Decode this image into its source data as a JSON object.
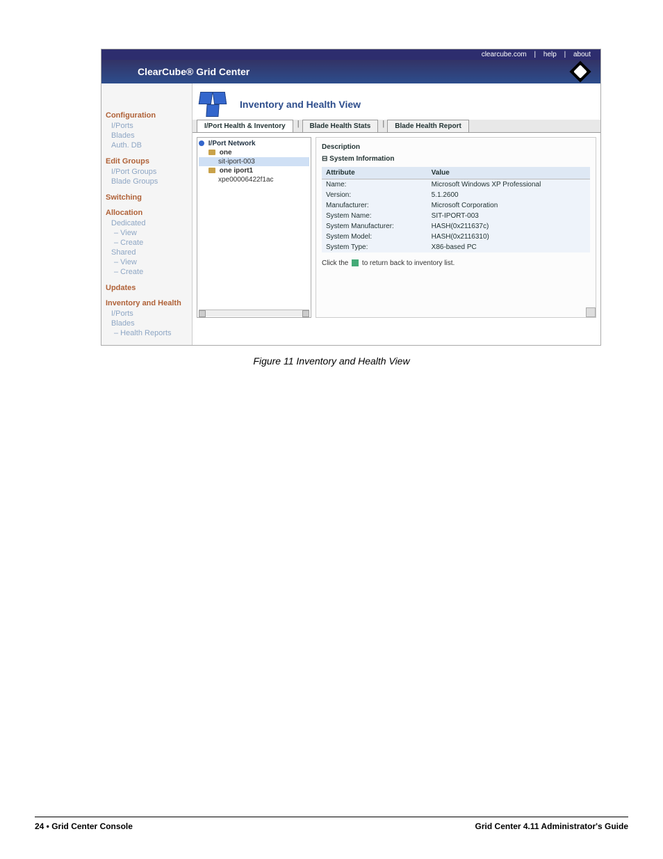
{
  "topbar": {
    "link1": "clearcube.com",
    "link2": "help",
    "link3": "about"
  },
  "brand": {
    "title": "ClearCube® Grid Center"
  },
  "header": {
    "page_title": "Inventory and Health View"
  },
  "tabs": {
    "t1": "I/Port Health & Inventory",
    "t2": "Blade Health Stats",
    "t3": "Blade Health Report"
  },
  "sidebar": {
    "sec1": "Configuration",
    "s1i1": "I/Ports",
    "s1i2": "Blades",
    "s1i3": "Auth. DB",
    "sec2": "Edit Groups",
    "s2i1": "I/Port Groups",
    "s2i2": "Blade Groups",
    "sec3": "Switching",
    "sec4": "Allocation",
    "s4i1": "Dedicated",
    "s4i2": "– View",
    "s4i3": "– Create",
    "s4i4": "Shared",
    "s4i5": "– View",
    "s4i6": "– Create",
    "sec5": "Updates",
    "sec6": "Inventory and Health",
    "s6i1": "I/Ports",
    "s6i2": "Blades",
    "s6i3": "– Health Reports"
  },
  "tree": {
    "root": "I/Port Network",
    "n1": "one",
    "n1a": "sit-iport-003",
    "n2": "one iport1",
    "n2a": "xpe00006422f1ac"
  },
  "detail": {
    "desc": "Description",
    "sysinfo": "⊟ System Information",
    "col1": "Attribute",
    "col2": "Value",
    "rows": [
      {
        "a": "Name:",
        "v": "Microsoft Windows XP Professional"
      },
      {
        "a": "Version:",
        "v": "5.1.2600"
      },
      {
        "a": "Manufacturer:",
        "v": "Microsoft Corporation"
      },
      {
        "a": "System Name:",
        "v": "SIT-IPORT-003"
      },
      {
        "a": "System Manufacturer:",
        "v": "HASH(0x211637c)"
      },
      {
        "a": "System Model:",
        "v": "HASH(0x2116310)"
      },
      {
        "a": "System Type:",
        "v": "X86-based PC"
      }
    ],
    "hint_pre": "Click the",
    "hint_post": "to return back to inventory list."
  },
  "caption": "Figure 11  Inventory and Health View",
  "footer": {
    "left_bold": "24 • Grid Center Console",
    "right": "Grid Center 4.11 Administrator's Guide"
  }
}
